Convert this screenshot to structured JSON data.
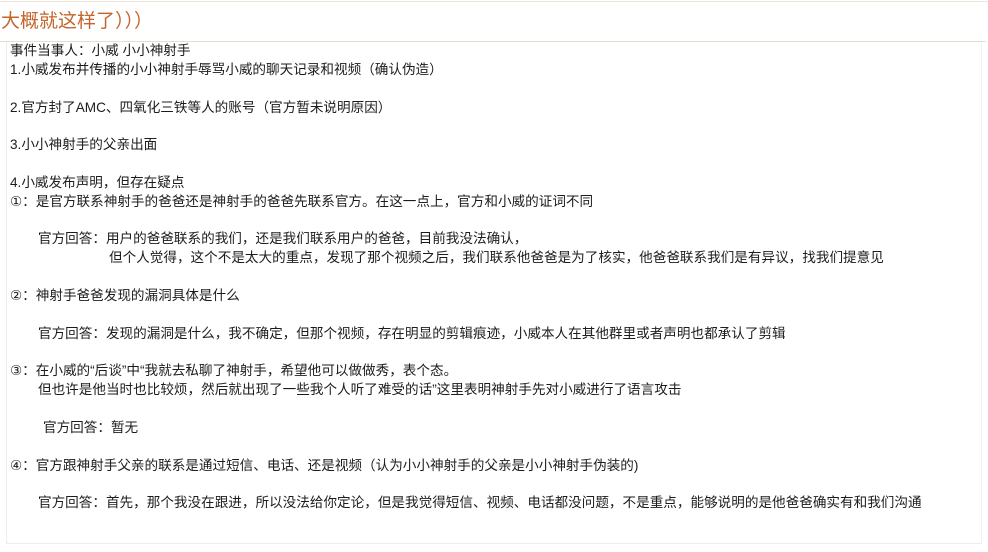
{
  "post": {
    "title": "大概就这样了）））",
    "parties": "事件当事人：小威 小小神射手",
    "facts": [
      "1.小威发布并传播的小小神射手辱骂小威的聊天记录和视频（确认伪造）",
      "2.官方封了AMC、四氧化三铁等人的账号（官方暂未说明原因）",
      "3.小小神射手的父亲出面",
      "4.小威发布声明，但存在疑点"
    ],
    "questions": [
      {
        "question_lines": [
          "①：是官方联系神射手的爸爸还是神射手的爸爸先联系官方。在这一点上，官方和小威的证词不同"
        ],
        "answer_lines": [
          "官方回答：用户的爸爸联系的我们，还是我们联系用户的爸爸，目前我没法确认，",
          "但个人觉得，这个不是太大的重点，发现了那个视频之后，我们联系他爸爸是为了核实，他爸爸联系我们是有异议，找我们提意见"
        ]
      },
      {
        "question_lines": [
          "②：神射手爸爸发现的漏洞具体是什么"
        ],
        "answer_lines": [
          "官方回答：发现的漏洞是什么，我不确定，但那个视频，存在明显的剪辑痕迹，小威本人在其他群里或者声明也都承认了剪辑"
        ]
      },
      {
        "question_lines": [
          "③：在小威的“后谈”中“我就去私聊了神射手，希望他可以做做秀，表个态。",
          "但也许是他当时也比较烦，然后就出现了一些我个人听了难受的话”这里表明神射手先对小威进行了语言攻击"
        ],
        "answer_lines": [
          "官方回答：暂无"
        ]
      },
      {
        "question_lines": [
          "④：官方跟神射手父亲的联系是通过短信、电话、还是视频（认为小小神射手的父亲是小小神射手伪装的)"
        ],
        "answer_lines": [
          "官方回答：首先，那个我没在跟进，所以没法给你定论，但是我觉得短信、视频、电话都没问题，不是重点，能够说明的是他爸爸确实有和我们沟通"
        ]
      }
    ]
  },
  "colors": {
    "title": "#c4652b",
    "text": "#1c1c1c",
    "divider": "#e9ddd0"
  }
}
